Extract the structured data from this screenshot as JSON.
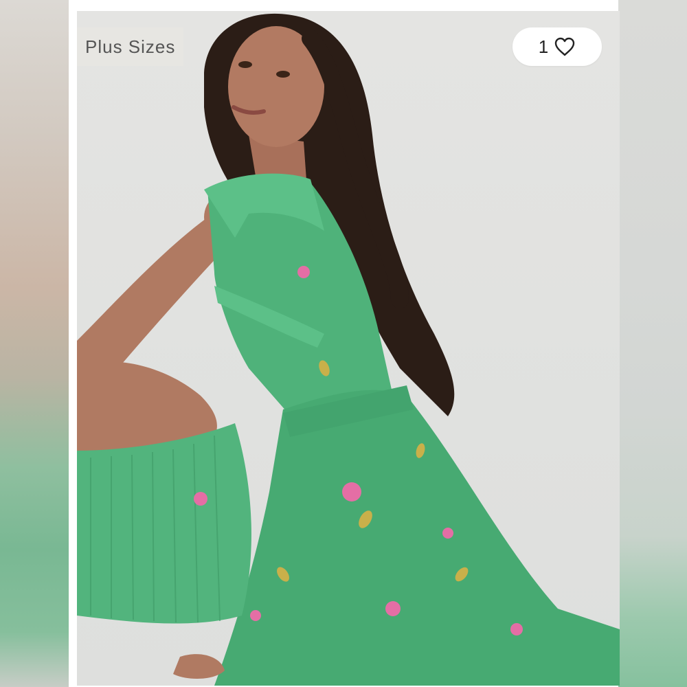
{
  "badge": {
    "label": "Plus Sizes"
  },
  "likes": {
    "count": "1",
    "icon": "heart-outline-icon"
  },
  "photo": {
    "subject": "model-in-green-floral-dress"
  },
  "colors": {
    "dress_green": "#4fb27a",
    "background": "#e2e2e0",
    "badge_bg": "#e8e6e2",
    "pill_bg": "#ffffff"
  }
}
